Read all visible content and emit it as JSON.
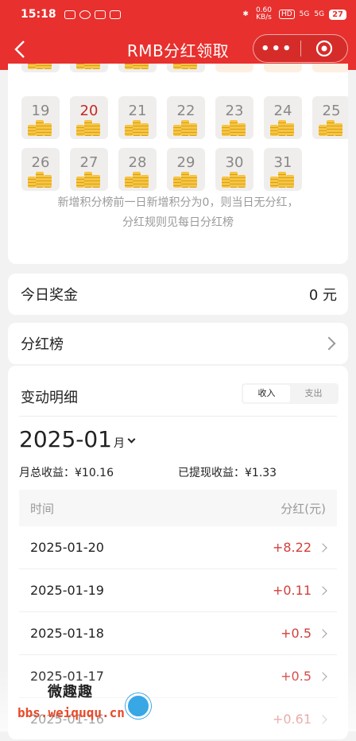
{
  "status_bar": {
    "time": "15:18",
    "net_speed": "0.60 KB/s",
    "hd": "HD",
    "sig1": "5G",
    "sig2": "5G",
    "battery": "27"
  },
  "nav": {
    "title": "RMB分红领取",
    "more_label": "•••"
  },
  "calendar": {
    "rows": [
      [
        "",
        "",
        "",
        "",
        "check",
        "check",
        "check"
      ],
      [
        "19",
        "20",
        "21",
        "22",
        "23",
        "24",
        "25"
      ],
      [
        "26",
        "27",
        "28",
        "29",
        "30",
        "31",
        ""
      ]
    ],
    "today": "20",
    "note_line1": "新增积分榜前一日新增积分为0，则当日无分红，",
    "note_line2": "分红规则见每日分红榜"
  },
  "bonus": {
    "label": "今日奖金",
    "value": "0 元"
  },
  "ranking": {
    "label": "分红榜"
  },
  "detail": {
    "title": "变动明细",
    "tabs": [
      "收入",
      "支出"
    ],
    "month": "2025-01",
    "month_unit": "月",
    "monthly_total": "月总收益：¥10.16",
    "withdrawn": "已提现收益：¥1.33",
    "col_time": "时间",
    "col_amount": "分红(元)",
    "rows": [
      {
        "date": "2025-01-20",
        "amount": "+8.22"
      },
      {
        "date": "2025-01-19",
        "amount": "+0.11"
      },
      {
        "date": "2025-01-18",
        "amount": "+0.5"
      },
      {
        "date": "2025-01-17",
        "amount": "+0.5"
      },
      {
        "date": "2025-01-16",
        "amount": "+0.61"
      }
    ]
  },
  "watermark": {
    "cn": "微趣趣",
    "url": "bbs.weiququ.cn"
  },
  "colors": {
    "brand_red": "#e8302e",
    "amount_red": "#d2403c"
  }
}
